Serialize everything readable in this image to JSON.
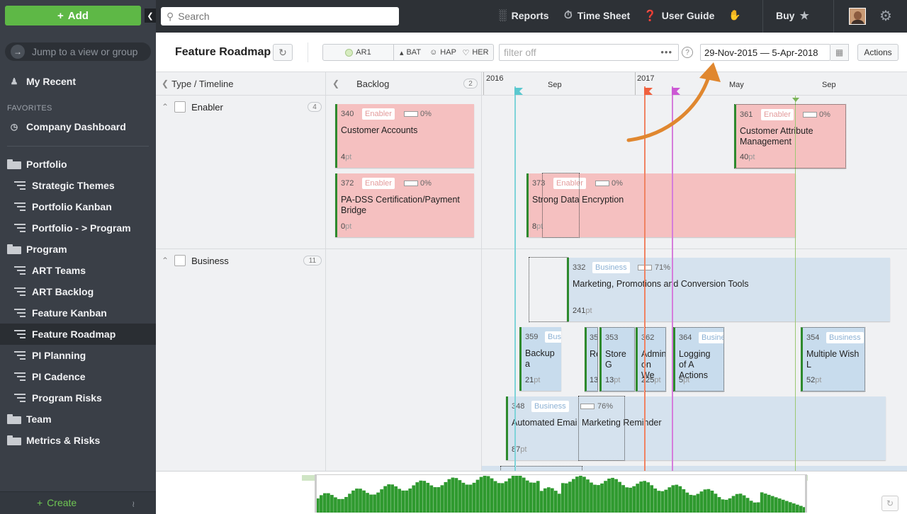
{
  "sidebar": {
    "add_label": "Add",
    "jump_placeholder": "Jump to a view or group",
    "my_recent": "My Recent",
    "favorites_label": "FAVORITES",
    "company_dashboard": "Company Dashboard",
    "portfolio": "Portfolio",
    "strategic_themes": "Strategic Themes",
    "portfolio_kanban": "Portfolio Kanban",
    "portfolio_program": "Portfolio - > Program",
    "program": "Program",
    "art_teams": "ART Teams",
    "art_backlog": "ART Backlog",
    "feature_kanban": "Feature Kanban",
    "feature_roadmap": "Feature Roadmap",
    "pi_planning": "PI Planning",
    "pi_cadence": "PI Cadence",
    "program_risks": "Program Risks",
    "team": "Team",
    "metrics_risks": "Metrics & Risks",
    "create_label": "Create"
  },
  "topbar": {
    "search_placeholder": "Search",
    "reports": "Reports",
    "time_sheet": "Time Sheet",
    "user_guide": "User Guide",
    "buy": "Buy"
  },
  "toolbar": {
    "title": "Feature Roadmap",
    "arts": [
      "AR1",
      "BAT",
      "HAP",
      "HER"
    ],
    "filter_placeholder": "filter off",
    "date_range": "29-Nov-2015 — 5-Apr-2018",
    "actions": "Actions"
  },
  "board": {
    "type_header": "Type / Timeline",
    "backlog_header": "Backlog",
    "backlog_count": "2",
    "timeline_labels": [
      "2016",
      "Sep",
      "2017",
      "May",
      "Sep"
    ],
    "lanes": [
      {
        "title": "Enabler",
        "count": "4"
      },
      {
        "title": "Business",
        "count": "11"
      }
    ],
    "cards": {
      "c340": {
        "id": "340",
        "tag": "Enabler",
        "pct": "0%",
        "title": "Customer Accounts",
        "pts": "4"
      },
      "c372": {
        "id": "372",
        "tag": "Enabler",
        "pct": "0%",
        "title": "PA-DSS Certification/Payment Bridge",
        "pts": "0"
      },
      "c361": {
        "id": "361",
        "tag": "Enabler",
        "pct": "0%",
        "title": "Customer Attribute Management",
        "pts": "40"
      },
      "c373": {
        "id": "373",
        "tag": "Enabler",
        "pct": "0%",
        "title": "Strong Data Encryption",
        "pts": "8"
      },
      "c332": {
        "id": "332",
        "tag": "Business",
        "pct": "71%",
        "progress": 0.71,
        "title": "Marketing, Promotions and Conversion Tools",
        "pts": "241"
      },
      "c359": {
        "id": "359",
        "tag": "Bus",
        "title": "Backup a",
        "pts": "21"
      },
      "c35x": {
        "id": "35",
        "title": "Re",
        "pts": "13"
      },
      "c353": {
        "id": "353",
        "tag": "",
        "title": "Store G",
        "pts": "13"
      },
      "c362": {
        "id": "362",
        "tag": "",
        "title": "Admin on We",
        "pts": "225"
      },
      "c364": {
        "id": "364",
        "tag": "Busine",
        "title": "Logging of A Actions",
        "pts": "5"
      },
      "c354": {
        "id": "354",
        "tag": "Business",
        "title": "Multiple Wish L",
        "pts": "52"
      },
      "c348": {
        "id": "348",
        "tag": "Business",
        "pct": "76%",
        "progress": 0.76,
        "title": "Automated Email",
        "title2": "Marketing Reminder",
        "pts": "87"
      }
    },
    "pt_unit": "pt"
  },
  "colors": {
    "accent_green": "#5eb846",
    "enabler_card": "#f5c0c0",
    "business_card": "#c8dced",
    "annotation_arrow": "#e0872f",
    "line_cyan": "#6ccfd6",
    "line_orange": "#f07050",
    "line_magenta": "#d070d8",
    "line_green": "#8cc060"
  }
}
